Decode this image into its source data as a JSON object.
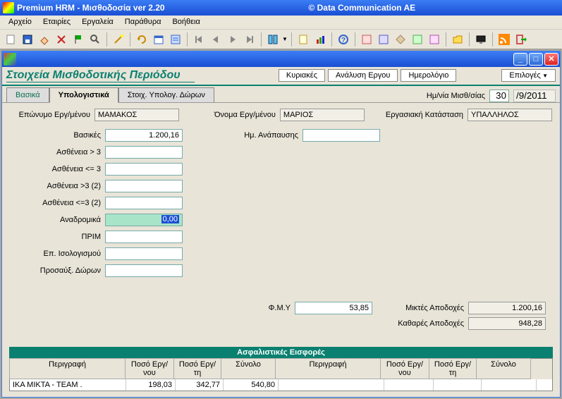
{
  "window": {
    "title_left": "Premium HRM - Μισθοδοσία ver 2.20",
    "title_center": "© Data Communication AE"
  },
  "menu": {
    "items": [
      "Αρχείο",
      "Εταιρίες",
      "Εργαλεία",
      "Παράθυρα",
      "Βοήθεια"
    ]
  },
  "form": {
    "title": "Στοιχεία Μισθοδοτικής Περιόδου",
    "buttons": {
      "kyriakes": "Κυριακές",
      "analysierg": "Ανάλυση Εργου",
      "hmerologio": "Ημερολόγιο",
      "epiloges": "Επιλογές"
    }
  },
  "tabs": {
    "t1": "Βασικά",
    "t2": "Υπολογιστικά",
    "t3": "Στοιχ. Υπολογ. Δώρων"
  },
  "date": {
    "label": "Ημ/νία Μισθ/σίας",
    "day": "30",
    "rest": "/9/2011"
  },
  "emp": {
    "surname_lbl": "Επώνυμο Εργ/μένου",
    "surname": "ΜΑΜΑΚΟΣ",
    "name_lbl": "Όνομα Εργ/μένου",
    "name": "ΜΑΡΙΟΣ",
    "status_lbl": "Εργασιακή Κατάσταση",
    "status": "ΥΠΑΛΛΗΛΟΣ"
  },
  "left_fields": {
    "basikes_lbl": "Βασικές",
    "basikes": "1.200,16",
    "asth3_lbl": "Ασθένεια > 3",
    "asth3": "",
    "asthle3_lbl": "Ασθένεια <= 3",
    "asthle3": "",
    "asth3b_lbl": "Ασθένεια >3 (2)",
    "asth3b": "",
    "asthle3b_lbl": "Ασθένεια <=3 (2)",
    "asthle3b": "",
    "anadromika_lbl": "Αναδρομικά",
    "anadromika": "0,00",
    "prim_lbl": "ΠΡΙΜ",
    "prim": "",
    "episol_lbl": "Επ. Ισολογισμού",
    "episol": "",
    "prosaux_lbl": "Προσαύξ. Δώρων",
    "prosaux": ""
  },
  "mid_fields": {
    "hmana_lbl": "Ημ.  Ανάπαυσης",
    "hmana": ""
  },
  "totals": {
    "fmy_lbl": "Φ.Μ.Υ",
    "fmy": "53,85",
    "miktes_lbl": "Μικτές Αποδοχές",
    "miktes": "1.200,16",
    "kathares_lbl": "Καθαρές Αποδοχές",
    "kathares": "948,28"
  },
  "grid": {
    "title": "Ασφαλιστικές Εισφορές",
    "headers": {
      "desc": "Περιγραφή",
      "posoErg": "Ποσό Εργ/νου",
      "posoErgti": "Ποσό Εργ/τη",
      "synolo": "Σύνολο"
    },
    "row": {
      "desc": "ΙΚΑ ΜΙΚΤΑ - ΤΕΑΜ        .",
      "posoErg": "198,03",
      "posoErgti": "342,77",
      "synolo": "540,80"
    }
  }
}
